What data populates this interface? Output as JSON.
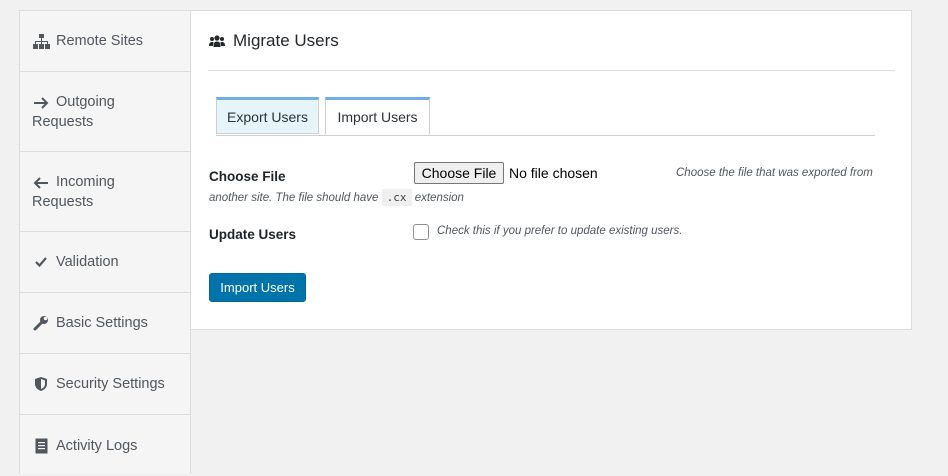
{
  "sidebar": {
    "items": [
      {
        "label": "Remote Sites",
        "icon": "sitemap-icon"
      },
      {
        "label_line1": "Outgoing",
        "label_line2": "Requests",
        "icon": "arrow-right-icon"
      },
      {
        "label_line1": "Incoming",
        "label_line2": "Requests",
        "icon": "arrow-left-icon"
      },
      {
        "label": "Validation",
        "icon": "checkmark-icon"
      },
      {
        "label": "Basic Settings",
        "icon": "wrench-icon"
      },
      {
        "label": "Security Settings",
        "icon": "shield-icon"
      },
      {
        "label": "Activity Logs",
        "icon": "document-icon"
      }
    ]
  },
  "main": {
    "title": "Migrate Users",
    "tabs": [
      {
        "label": "Export Users",
        "active": false
      },
      {
        "label": "Import Users",
        "active": true
      }
    ],
    "choose_file": {
      "label": "Choose File",
      "button": "Choose File",
      "status": "No file chosen",
      "description_part1": "Choose the file that was exported from",
      "description_part2": "another site. The file should have",
      "extension": ".cx",
      "description_part3": "extension"
    },
    "update_users": {
      "label": "Update Users",
      "checked": false,
      "description": "Check this if you prefer to update existing users."
    },
    "submit_label": "Import Users"
  },
  "colors": {
    "primary": "#0073aa",
    "tab_accent": "#72aee6",
    "inactive_tab_bg": "#e5f5fa"
  }
}
